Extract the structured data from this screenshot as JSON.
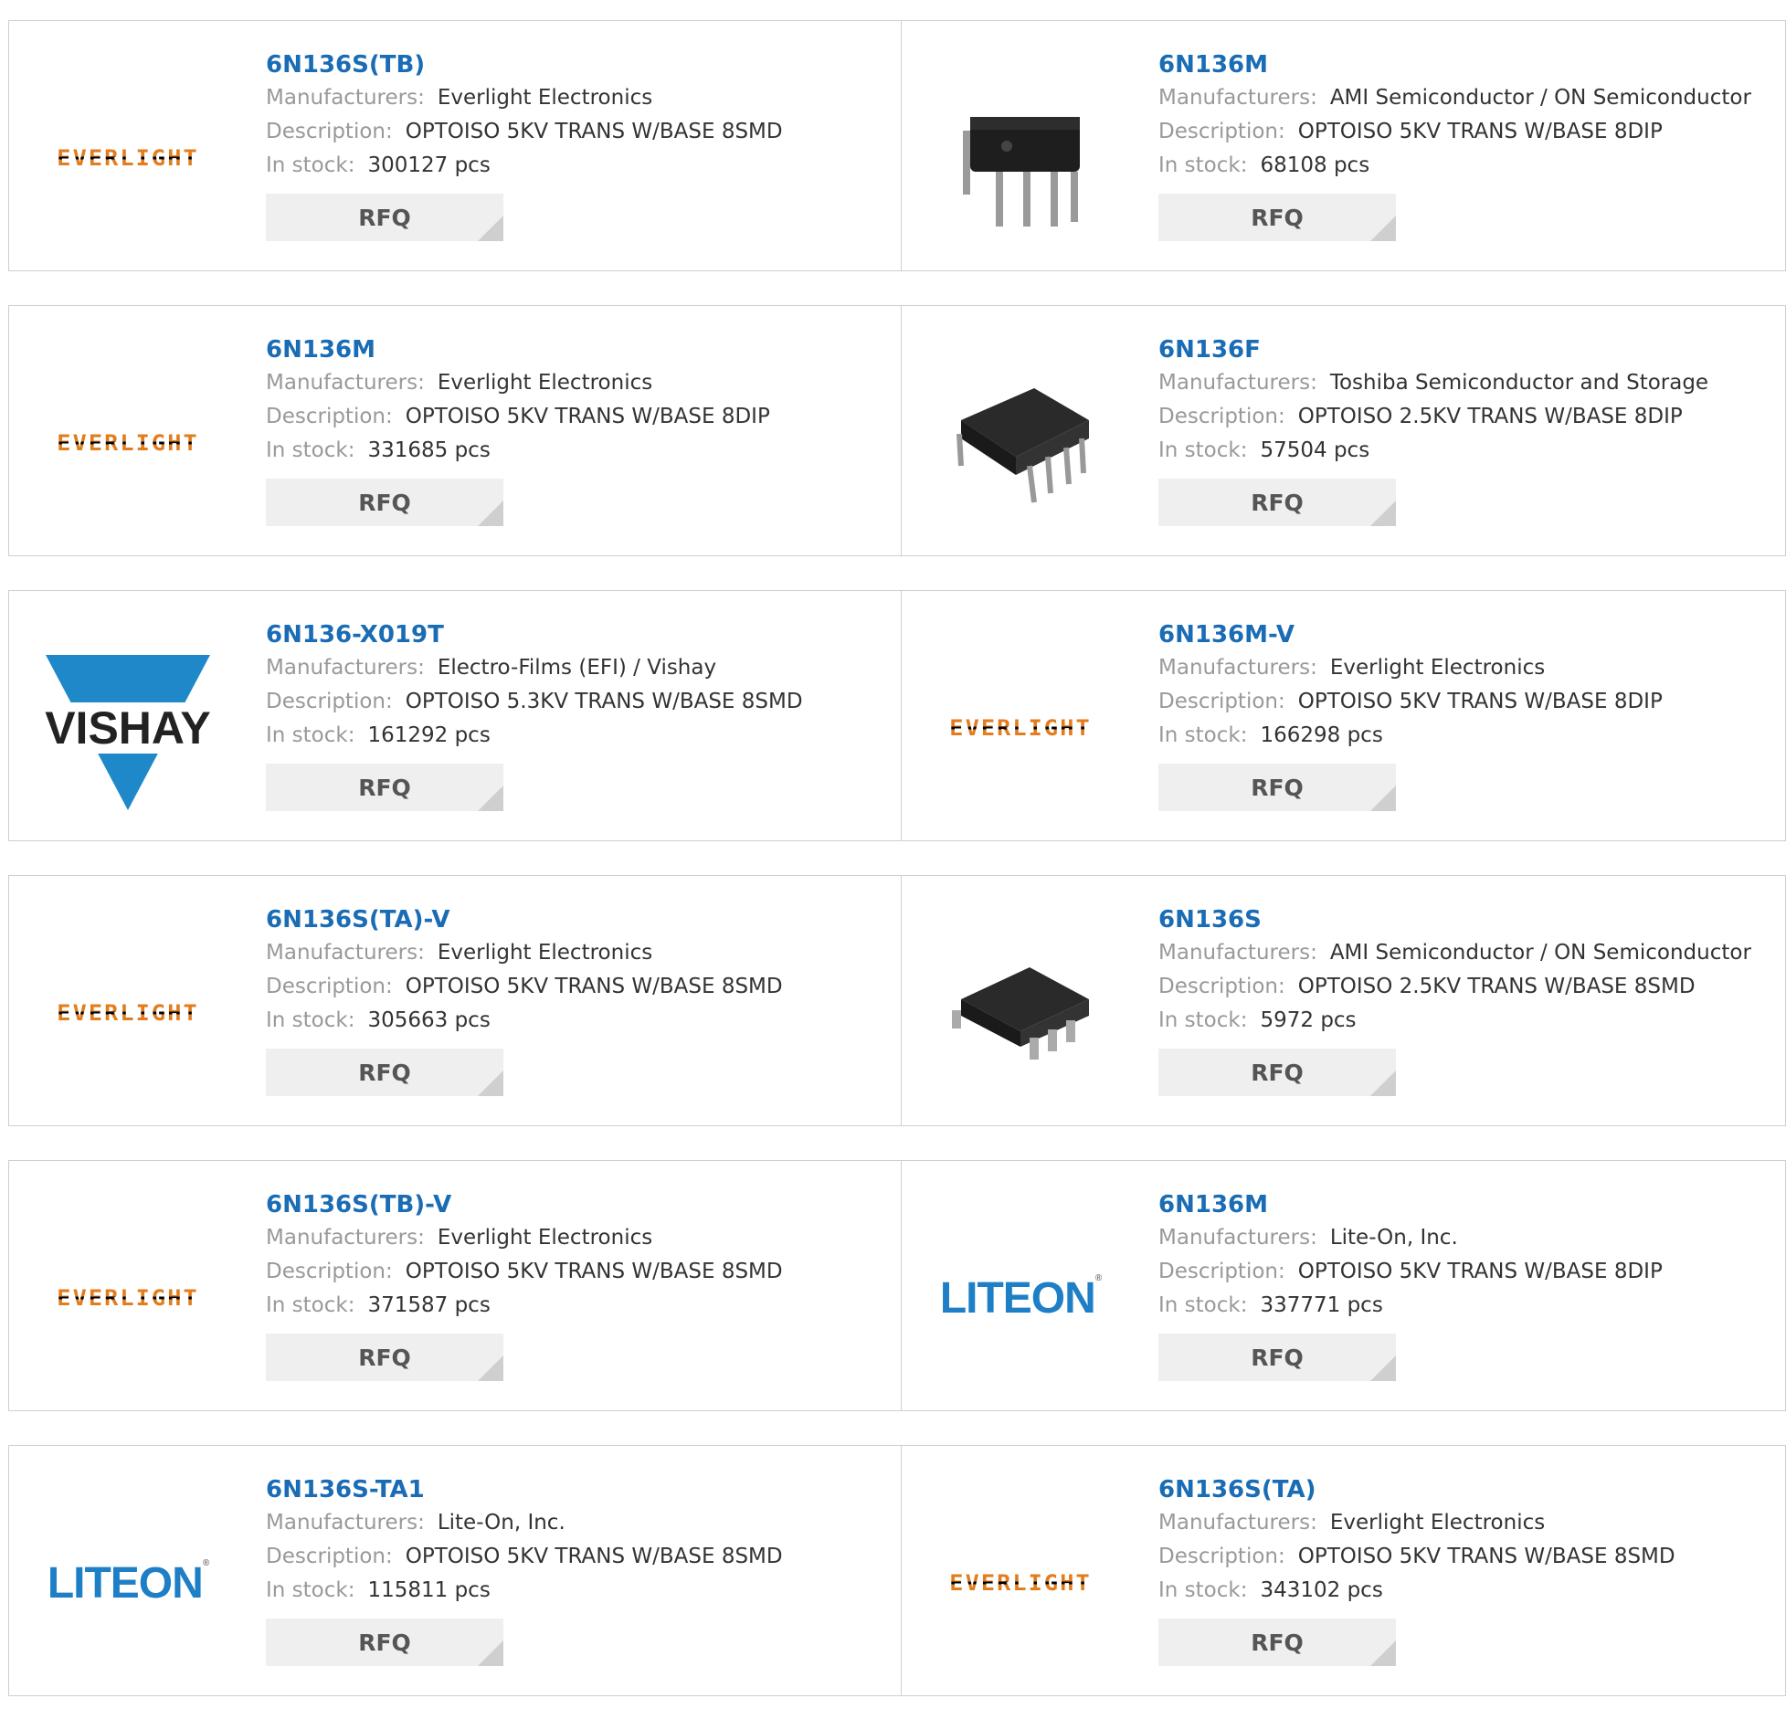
{
  "labels": {
    "manufacturers": "Manufacturers:",
    "description": "Description:",
    "in_stock": "In stock:",
    "rfq": "RFQ"
  },
  "items": [
    {
      "part": "6N136S(TB)",
      "logo": "everlight",
      "logo_text": "EVERLIGHT",
      "manufacturer": "Everlight Electronics",
      "description": "OPTOISO 5KV TRANS W/BASE 8SMD",
      "stock": "300127 pcs"
    },
    {
      "part": "6N136M",
      "logo": "chip-dip",
      "manufacturer": "AMI Semiconductor / ON Semiconductor",
      "description": "OPTOISO 5KV TRANS W/BASE 8DIP",
      "stock": "68108 pcs"
    },
    {
      "part": "6N136M",
      "logo": "everlight",
      "logo_text": "EVERLIGHT",
      "manufacturer": "Everlight Electronics",
      "description": "OPTOISO 5KV TRANS W/BASE 8DIP",
      "stock": "331685 pcs"
    },
    {
      "part": "6N136F",
      "logo": "chip-dip-angled",
      "manufacturer": "Toshiba Semiconductor and Storage",
      "description": "OPTOISO 2.5KV TRANS W/BASE 8DIP",
      "stock": "57504 pcs"
    },
    {
      "part": "6N136-X019T",
      "logo": "vishay",
      "logo_text": "VISHAY",
      "manufacturer": "Electro-Films (EFI) / Vishay",
      "description": "OPTOISO 5.3KV TRANS W/BASE 8SMD",
      "stock": "161292 pcs"
    },
    {
      "part": "6N136M-V",
      "logo": "everlight",
      "logo_text": "EVERLIGHT",
      "manufacturer": "Everlight Electronics",
      "description": "OPTOISO 5KV TRANS W/BASE 8DIP",
      "stock": "166298 pcs"
    },
    {
      "part": "6N136S(TA)-V",
      "logo": "everlight",
      "logo_text": "EVERLIGHT",
      "manufacturer": "Everlight Electronics",
      "description": "OPTOISO 5KV TRANS W/BASE 8SMD",
      "stock": "305663 pcs"
    },
    {
      "part": "6N136S",
      "logo": "chip-smd",
      "manufacturer": "AMI Semiconductor / ON Semiconductor",
      "description": "OPTOISO 2.5KV TRANS W/BASE 8SMD",
      "stock": "5972 pcs"
    },
    {
      "part": "6N136S(TB)-V",
      "logo": "everlight",
      "logo_text": "EVERLIGHT",
      "manufacturer": "Everlight Electronics",
      "description": "OPTOISO 5KV TRANS W/BASE 8SMD",
      "stock": "371587 pcs"
    },
    {
      "part": "6N136M",
      "logo": "liteon",
      "logo_text": "LITEON",
      "manufacturer": "Lite-On, Inc.",
      "description": "OPTOISO 5KV TRANS W/BASE 8DIP",
      "stock": "337771 pcs"
    },
    {
      "part": "6N136S-TA1",
      "logo": "liteon",
      "logo_text": "LITEON",
      "manufacturer": "Lite-On, Inc.",
      "description": "OPTOISO 5KV TRANS W/BASE 8SMD",
      "stock": "115811 pcs"
    },
    {
      "part": "6N136S(TA)",
      "logo": "everlight",
      "logo_text": "EVERLIGHT",
      "manufacturer": "Everlight Electronics",
      "description": "OPTOISO 5KV TRANS W/BASE 8SMD",
      "stock": "343102 pcs"
    }
  ],
  "colors": {
    "link": "#1a6cb5",
    "everlight": "#e37c1d",
    "vishay": "#1e88c9",
    "liteon": "#1e7fc6"
  }
}
